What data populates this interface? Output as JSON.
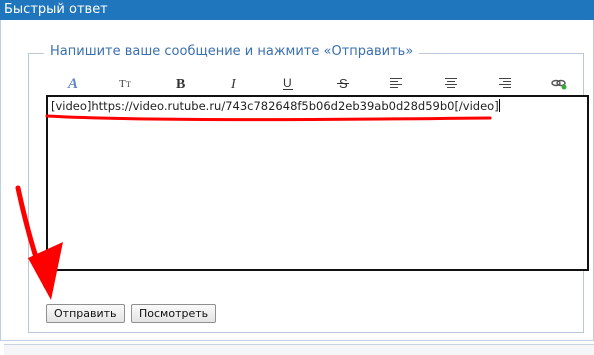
{
  "header": {
    "title": "Быстрый ответ"
  },
  "form": {
    "legend": "Напишите ваше сообщение и нажмите «Отправить»",
    "editor_text": "[video]https://video.rutube.ru/743c782648f5b06d2eb39ab0d28d59b0[/video]",
    "submit_label": "Отправить",
    "preview_label": "Посмотреть"
  },
  "toolbar": {
    "icons": [
      "font-color-icon",
      "font-size-icon",
      "bold-icon",
      "italic-icon",
      "underline-icon",
      "strikethrough-icon",
      "align-left-icon",
      "align-center-icon",
      "align-right-icon",
      "insert-link-icon"
    ]
  },
  "annotation": {
    "color": "#ff0000"
  }
}
